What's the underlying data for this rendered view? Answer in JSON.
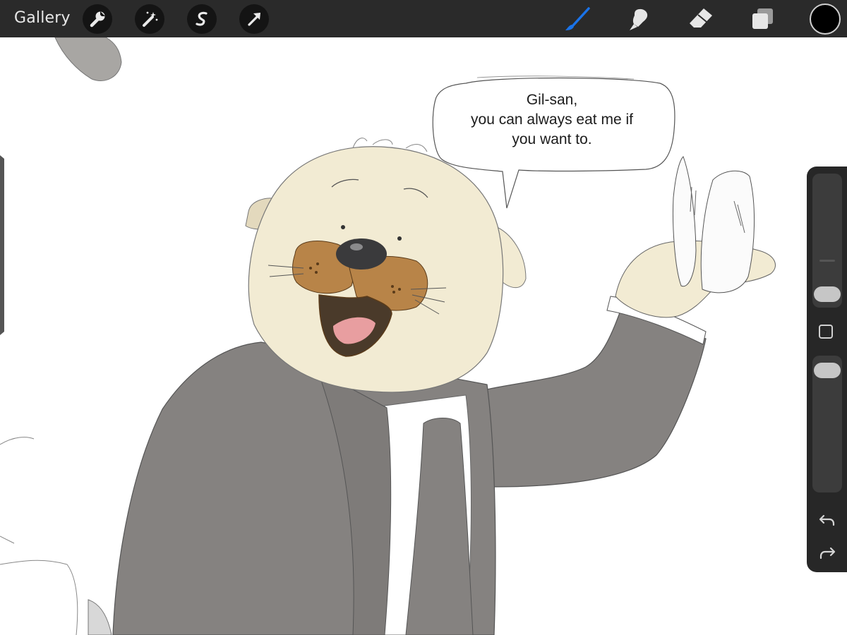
{
  "toolbar": {
    "gallery_label": "Gallery",
    "left_tools": [
      "wrench-icon",
      "magic-wand-icon",
      "selection-icon",
      "transform-arrow-icon"
    ],
    "right_tools": [
      "brush-icon",
      "smudge-icon",
      "eraser-icon",
      "layers-icon"
    ],
    "active_tool": "brush-icon",
    "active_color": "#1a73e8",
    "current_color": "#000000"
  },
  "canvas": {
    "speech_bubble": {
      "lines": [
        "Gil-san,",
        "you can always eat me if",
        "you want to."
      ]
    }
  },
  "sidebar": {
    "sliders": [
      "brush-size-slider",
      "opacity-slider"
    ],
    "undo_icon": "undo-icon",
    "redo_icon": "redo-icon"
  },
  "colors": {
    "toolbar_bg": "#2a2a2a",
    "sidebar_bg": "#272727",
    "otter_fur": "#f2ebd3",
    "otter_muzzle": "#b88448",
    "suit": "#858280",
    "canvas_bg": "#ffffff"
  }
}
